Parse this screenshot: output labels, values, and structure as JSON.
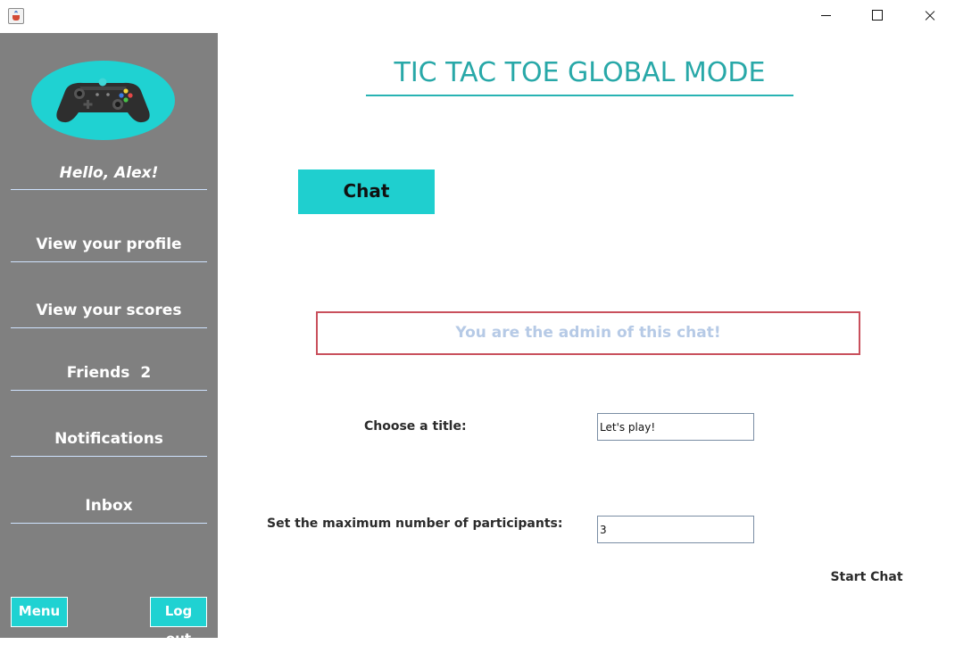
{
  "window": {
    "app_icon": "java-cup-icon",
    "minimize_icon": "minimize-icon",
    "maximize_icon": "maximize-icon",
    "close_icon": "close-icon"
  },
  "sidebar": {
    "logo_icon": "gamepad-icon",
    "greeting": "Hello, Alex!",
    "items": [
      {
        "label": "View your profile"
      },
      {
        "label": "View your scores"
      },
      {
        "label": "Friends",
        "count": "2"
      },
      {
        "label": "Notifications"
      },
      {
        "label": "Inbox"
      }
    ],
    "menu_label": "Menu",
    "logout_label": "Log out",
    "colors": {
      "background": "#808080",
      "accent": "#1fd2d2"
    }
  },
  "main": {
    "title": "TIC TAC TOE GLOBAL MODE",
    "chat_button": "Chat",
    "admin_notice": "You are the admin of this chat!",
    "title_label": "Choose a title:",
    "title_value": "Let's play!",
    "max_label": "Set the maximum number of participants:",
    "max_value": "3",
    "start_button": "Start Chat",
    "colors": {
      "title": "#28a8a8",
      "notice_border": "#c9505c",
      "notice_text": "#b6cae6"
    }
  }
}
